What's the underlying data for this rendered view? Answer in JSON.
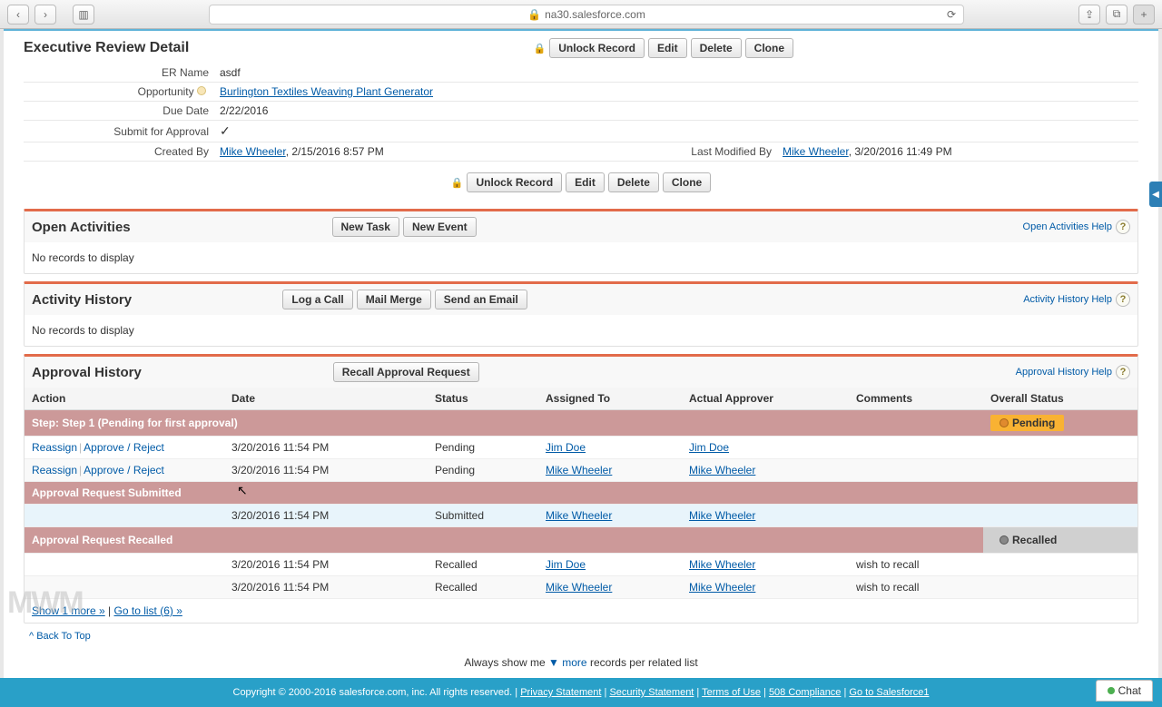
{
  "browser": {
    "url_label": "na30.salesforce.com"
  },
  "detail": {
    "title": "Executive Review Detail",
    "buttons": {
      "unlock": "Unlock Record",
      "edit": "Edit",
      "delete": "Delete",
      "clone": "Clone"
    },
    "fields": {
      "er_name_label": "ER Name",
      "er_name_value": "asdf",
      "opportunity_label": "Opportunity",
      "opportunity_value": "Burlington Textiles Weaving Plant Generator",
      "due_date_label": "Due Date",
      "due_date_value": "2/22/2016",
      "submit_label": "Submit for Approval",
      "created_by_label": "Created By",
      "created_by_name": "Mike Wheeler",
      "created_by_time": ", 2/15/2016 8:57 PM",
      "last_mod_label": "Last Modified By",
      "last_mod_name": "Mike Wheeler",
      "last_mod_time": ", 3/20/2016 11:49 PM"
    }
  },
  "open_activities": {
    "title": "Open Activities",
    "buttons": {
      "new_task": "New Task",
      "new_event": "New Event"
    },
    "help": "Open Activities Help",
    "empty": "No records to display"
  },
  "activity_history": {
    "title": "Activity History",
    "buttons": {
      "log_call": "Log a Call",
      "mail_merge": "Mail Merge",
      "send_email": "Send an Email"
    },
    "help": "Activity History Help",
    "empty": "No records to display"
  },
  "approval": {
    "title": "Approval History",
    "recall_btn": "Recall Approval Request",
    "help": "Approval History Help",
    "cols": {
      "action": "Action",
      "date": "Date",
      "status": "Status",
      "assigned": "Assigned To",
      "approver": "Actual Approver",
      "comments": "Comments",
      "overall": "Overall Status"
    },
    "step1_label": "Step: Step 1 (Pending for first approval)",
    "pending_label": "Pending",
    "actions": {
      "reassign": "Reassign",
      "approve_reject": "Approve / Reject"
    },
    "row1": {
      "date": "3/20/2016 11:54 PM",
      "status": "Pending",
      "assigned": "Jim Doe",
      "approver": "Jim Doe"
    },
    "row2": {
      "date": "3/20/2016 11:54 PM",
      "status": "Pending",
      "assigned": "Mike Wheeler",
      "approver": "Mike Wheeler"
    },
    "submitted_label": "Approval Request Submitted",
    "row3": {
      "date": "3/20/2016 11:54 PM",
      "status": "Submitted",
      "assigned": "Mike Wheeler",
      "approver": "Mike Wheeler"
    },
    "recalled_label": "Approval Request Recalled",
    "recalled_status": "Recalled",
    "row4": {
      "date": "3/20/2016 11:54 PM",
      "status": "Recalled",
      "assigned": "Jim Doe",
      "approver": "Mike Wheeler",
      "comments": "wish to recall"
    },
    "row5": {
      "date": "3/20/2016 11:54 PM",
      "status": "Recalled",
      "assigned": "Mike Wheeler",
      "approver": "Mike Wheeler",
      "comments": "wish to recall"
    },
    "show_more": "Show 1 more »",
    "go_to_list": "Go to list (6) »"
  },
  "back_top": "Back To Top",
  "always_show": {
    "prefix": "Always show me ",
    "more": "more",
    "suffix": " records per related list"
  },
  "footer": {
    "copyright": "Copyright © 2000-2016 salesforce.com, inc. All rights reserved.",
    "privacy": "Privacy Statement",
    "security": "Security Statement",
    "terms": "Terms of Use",
    "compliance": "508 Compliance",
    "goto": "Go to Salesforce1"
  },
  "chat": "Chat"
}
